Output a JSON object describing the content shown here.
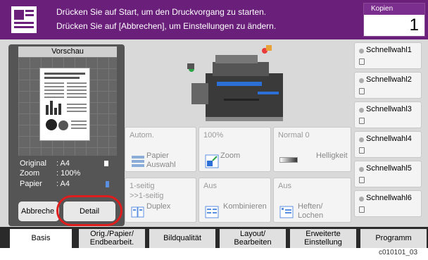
{
  "header": {
    "message_line1": "Drücken Sie auf Start, um den Druckvorgang zu starten.",
    "message_line2": "Drücken Sie auf [Abbrechen], um Einstellungen zu ändern.",
    "copies_label": "Kopien",
    "copies_value": "1",
    "icon": "job-icon"
  },
  "preview": {
    "title": "Vorschau",
    "original_label": "Original",
    "original_value": ": A4",
    "zoom_label": "Zoom",
    "zoom_value": ": 100%",
    "paper_label": "Papier",
    "paper_value": ": A4",
    "cancel_label": "Abbreche",
    "detail_label": "Detail"
  },
  "functions": [
    {
      "value": "Autom.",
      "label": "Papier\nAuswahl",
      "icon": "paper-select-icon"
    },
    {
      "value": "100%",
      "label": "Zoom",
      "icon": "zoom-icon"
    },
    {
      "value": "Normal 0",
      "label": "Helligkeit",
      "icon": "brightness-icon"
    },
    {
      "value": "1-seitig\n>>1-seitig",
      "label": "Duplex",
      "icon": "duplex-icon"
    },
    {
      "value": "Aus",
      "label": "Kombinieren",
      "icon": "combine-icon"
    },
    {
      "value": "Aus",
      "label": "Heften/\nLochen",
      "icon": "staple-punch-icon"
    }
  ],
  "quick_buttons": [
    "Schnellwahl1",
    "Schnellwahl2",
    "Schnellwahl3",
    "Schnellwahl4",
    "Schnellwahl5",
    "Schnellwahl6"
  ],
  "tabs": [
    "Basis",
    "Orig./Papier/\nEndbearbeit.",
    "Bildqualität",
    "Layout/\nBearbeiten",
    "Erweiterte\nEinstellung",
    "Programm"
  ],
  "footer_code": "c010101_03",
  "colors": {
    "header": "#6a1f7a",
    "highlight": "#e01d1d"
  }
}
